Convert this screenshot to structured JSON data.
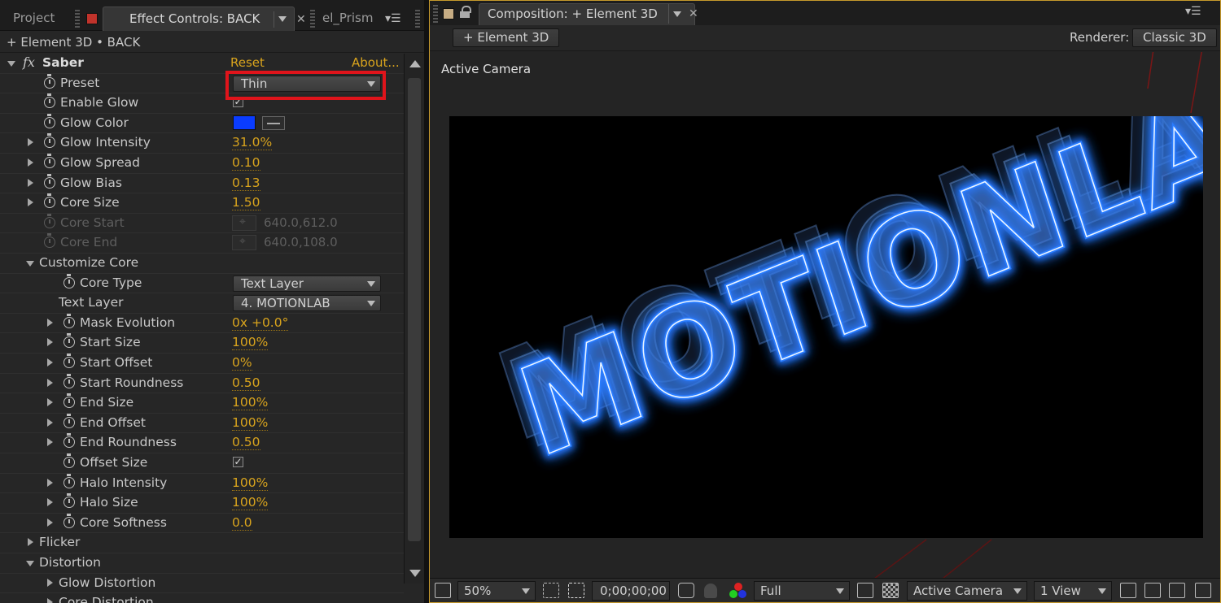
{
  "left_panel": {
    "tabs": {
      "project": "Project",
      "effect_controls": "Effect Controls: BACK",
      "third": "el_Prism"
    },
    "subheader": "+ Element 3D • BACK",
    "effect": {
      "name": "Saber",
      "fx_symbol": "fx",
      "reset": "Reset",
      "about": "About..."
    },
    "properties": {
      "preset": {
        "label": "Preset",
        "value": "Thin"
      },
      "enable_glow": {
        "label": "Enable Glow",
        "checked": "✓"
      },
      "glow_color": {
        "label": "Glow Color",
        "color": "#0a3cff"
      },
      "glow_intensity": {
        "label": "Glow Intensity",
        "value": "31.0%"
      },
      "glow_spread": {
        "label": "Glow Spread",
        "value": "0.10"
      },
      "glow_bias": {
        "label": "Glow Bias",
        "value": "0.13"
      },
      "core_size": {
        "label": "Core Size",
        "value": "1.50"
      },
      "core_start": {
        "label": "Core Start",
        "value": "640.0,612.0"
      },
      "core_end": {
        "label": "Core End",
        "value": "640.0,108.0"
      },
      "customize_core": {
        "label": "Customize Core"
      },
      "core_type": {
        "label": "Core Type",
        "value": "Text Layer"
      },
      "text_layer": {
        "label": "Text Layer",
        "value": "4. MOTIONLAB"
      },
      "mask_evolution": {
        "label": "Mask Evolution",
        "value": "0x +0.0°"
      },
      "start_size": {
        "label": "Start Size",
        "value": "100%"
      },
      "start_offset": {
        "label": "Start Offset",
        "value": "0%"
      },
      "start_roundness": {
        "label": "Start Roundness",
        "value": "0.50"
      },
      "end_size": {
        "label": "End Size",
        "value": "100%"
      },
      "end_offset": {
        "label": "End Offset",
        "value": "100%"
      },
      "end_roundness": {
        "label": "End Roundness",
        "value": "0.50"
      },
      "offset_size": {
        "label": "Offset Size",
        "checked": "✓"
      },
      "halo_intensity": {
        "label": "Halo Intensity",
        "value": "100%"
      },
      "halo_size": {
        "label": "Halo Size",
        "value": "100%"
      },
      "core_softness": {
        "label": "Core Softness",
        "value": "0.0"
      },
      "flicker": {
        "label": "Flicker"
      },
      "distortion": {
        "label": "Distortion"
      },
      "glow_distortion": {
        "label": "Glow Distortion"
      },
      "core_distortion": {
        "label": "Core Distortion"
      }
    }
  },
  "right_panel": {
    "tab": "Composition: + Element 3D",
    "comp_button": "+ Element 3D",
    "renderer_label": "Renderer:",
    "renderer_value": "Classic 3D",
    "view_label": "Active Camera",
    "canvas_text": "MOTIONLAB",
    "glow_color": "#2a7dff",
    "bottom": {
      "zoom": "50%",
      "timecode": "0;00;00;00",
      "resolution": "Full",
      "camera": "Active Camera",
      "views": "1 View"
    }
  }
}
